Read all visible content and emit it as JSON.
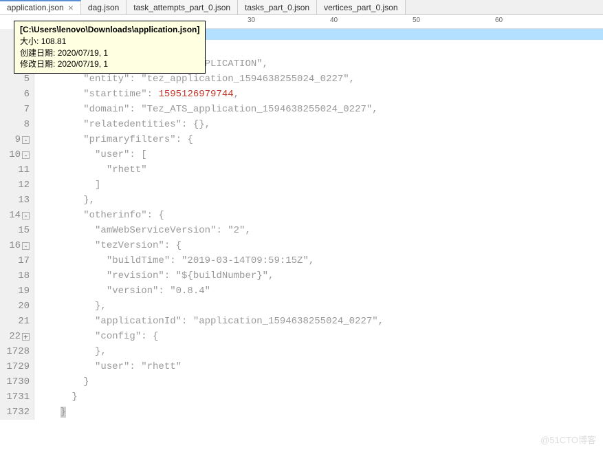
{
  "tabs": [
    {
      "label": "application.json",
      "active": true,
      "closable": true
    },
    {
      "label": "dag.json",
      "active": false,
      "closable": false
    },
    {
      "label": "task_attempts_part_0.json",
      "active": false,
      "closable": false
    },
    {
      "label": "tasks_part_0.json",
      "active": false,
      "closable": false
    },
    {
      "label": "vertices_part_0.json",
      "active": false,
      "closable": false
    }
  ],
  "ruler": {
    "marks": [
      "30",
      "40",
      "50",
      "60"
    ]
  },
  "tooltip": {
    "path": "[C:\\Users\\lenovo\\Downloads\\application.json]",
    "size_label": "大小:",
    "size_value": "108.81",
    "created_label": "创建日期:",
    "created_value": "2020/07/19, 1",
    "modified_label": "修改日期:",
    "modified_value": "2020/07/19, 1"
  },
  "lines": [
    {
      "num": "4",
      "indent": "        ",
      "text": "\"entitytype\": \"TEZ_APPLICATION\","
    },
    {
      "num": "5",
      "indent": "        ",
      "text": "\"entity\": \"tez_application_1594638255024_0227\","
    },
    {
      "num": "6",
      "indent": "        ",
      "prefix": "\"starttime\": ",
      "highlight": "1595126979744",
      "suffix": ","
    },
    {
      "num": "7",
      "indent": "        ",
      "text": "\"domain\": \"Tez_ATS_application_1594638255024_0227\","
    },
    {
      "num": "8",
      "indent": "        ",
      "text": "\"relatedentities\": {},"
    },
    {
      "num": "9",
      "fold": "-",
      "indent": "        ",
      "text": "\"primaryfilters\": {"
    },
    {
      "num": "10",
      "fold": "-",
      "indent": "          ",
      "text": "\"user\": ["
    },
    {
      "num": "11",
      "indent": "            ",
      "text": "\"rhett\""
    },
    {
      "num": "12",
      "indent": "          ",
      "text": "]"
    },
    {
      "num": "13",
      "indent": "        ",
      "text": "},"
    },
    {
      "num": "14",
      "fold": "-",
      "indent": "        ",
      "text": "\"otherinfo\": {"
    },
    {
      "num": "15",
      "indent": "          ",
      "text": "\"amWebServiceVersion\": \"2\","
    },
    {
      "num": "16",
      "fold": "-",
      "indent": "          ",
      "text": "\"tezVersion\": {"
    },
    {
      "num": "17",
      "indent": "            ",
      "text": "\"buildTime\": \"2019-03-14T09:59:15Z\","
    },
    {
      "num": "18",
      "indent": "            ",
      "text": "\"revision\": \"${buildNumber}\","
    },
    {
      "num": "19",
      "indent": "            ",
      "text": "\"version\": \"0.8.4\""
    },
    {
      "num": "20",
      "indent": "          ",
      "text": "},"
    },
    {
      "num": "21",
      "indent": "          ",
      "text": "\"applicationId\": \"application_1594638255024_0227\","
    },
    {
      "num": "22",
      "fold": "+",
      "indent": "          ",
      "text": "\"config\": {"
    },
    {
      "num": "1728",
      "indent": "          ",
      "text": "},"
    },
    {
      "num": "1729",
      "indent": "          ",
      "text": "\"user\": \"rhett\""
    },
    {
      "num": "1730",
      "indent": "        ",
      "text": "}"
    },
    {
      "num": "1731",
      "indent": "      ",
      "text": "}"
    },
    {
      "num": "1732",
      "indent": "    ",
      "text": "}",
      "cursor": true
    }
  ],
  "watermark": "@51CTO博客"
}
